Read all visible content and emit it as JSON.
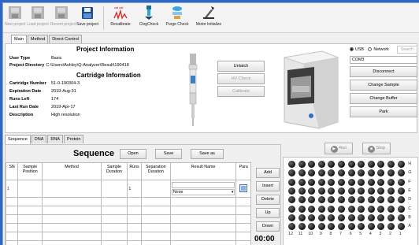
{
  "toolbar": [
    {
      "name": "new-project-button",
      "label": "New project",
      "disabled": true,
      "icon": "new-project-icon"
    },
    {
      "name": "load-project-button",
      "label": "Load project",
      "disabled": true,
      "icon": "load-project-icon"
    },
    {
      "name": "recent-project-button",
      "label": "Recent project",
      "disabled": true,
      "icon": "recent-project-icon"
    },
    {
      "name": "save-project-button",
      "label": "Save project",
      "disabled": false,
      "icon": "save-project-icon"
    },
    {
      "name": "recalibrate-button",
      "label": "Recalibrate",
      "disabled": false,
      "icon": "recalibrate-icon"
    },
    {
      "name": "clog-check-button",
      "label": "ClogCheck",
      "disabled": false,
      "icon": "clog-check-icon"
    },
    {
      "name": "purge-check-button",
      "label": "Purge Check",
      "disabled": false,
      "icon": "purge-check-icon"
    },
    {
      "name": "motor-initialize-button",
      "label": "Motor Initialize",
      "disabled": false,
      "icon": "motor-initialize-icon"
    }
  ],
  "main_tabs": [
    "Main",
    "Method",
    "Direct Control"
  ],
  "project": {
    "title": "Project Information",
    "user_type_label": "User Type",
    "user_type": "Basic",
    "directory_label": "Project Directory",
    "directory": "C:\\Users\\Ashley\\Q-Analyzer\\Result\\190418"
  },
  "cartridge": {
    "title": "Cartridge Information",
    "fields": [
      {
        "label": "Cartridge Number",
        "value": "51-0-190304-3"
      },
      {
        "label": "Expiration Date",
        "value": "2019-Aug-31"
      },
      {
        "label": "Runs Left",
        "value": "174"
      },
      {
        "label": "Last Run Date",
        "value": "2019-Apr-17"
      },
      {
        "label": "Description",
        "value": "High resolution"
      }
    ]
  },
  "cartridge_buttons": {
    "unlatch": "Unlatch",
    "hv_check": "HV Check",
    "calibrate": "Calibrate"
  },
  "connection": {
    "usb_label": "USB",
    "network_label": "Network",
    "search_label": "Search",
    "port": "COM3",
    "disconnect": "Disconnect",
    "change_sample": "Change Sample",
    "change_buffer": "Change Buffer",
    "park": "Park"
  },
  "seq_tabs": [
    "Sequence",
    "DNA",
    "RNA",
    "Protein"
  ],
  "sequence": {
    "title": "Sequence",
    "open": "Open",
    "save": "Save",
    "save_as": "Save as",
    "columns": [
      "SN",
      "Sample Position",
      "Method",
      "Sample Duration",
      "Runs",
      "Separation Duration",
      "Result Name",
      "Para"
    ],
    "rows": [
      {
        "sn": "1",
        "position": "",
        "method": "",
        "sample_duration": "",
        "runs": "1",
        "separation_duration": "",
        "result_name": "",
        "method_select": "None"
      }
    ],
    "add": "Add",
    "insert": "Insert",
    "delete": "Delete",
    "up": "Up",
    "down": "Down",
    "timer": "00:00"
  },
  "run_controls": {
    "run": "Run",
    "stop": "Stop"
  },
  "plate": {
    "row_labels": [
      "H",
      "G",
      "F",
      "E",
      "D",
      "C",
      "B",
      "A"
    ],
    "col_labels": [
      "12",
      "11",
      "10",
      "9",
      "8",
      "7",
      "6",
      "5",
      "4",
      "3",
      "2",
      "1"
    ]
  },
  "colors": {
    "titlebar": "#2a67c9",
    "error_text": "#cc0000",
    "well": "#1a1a1a"
  }
}
